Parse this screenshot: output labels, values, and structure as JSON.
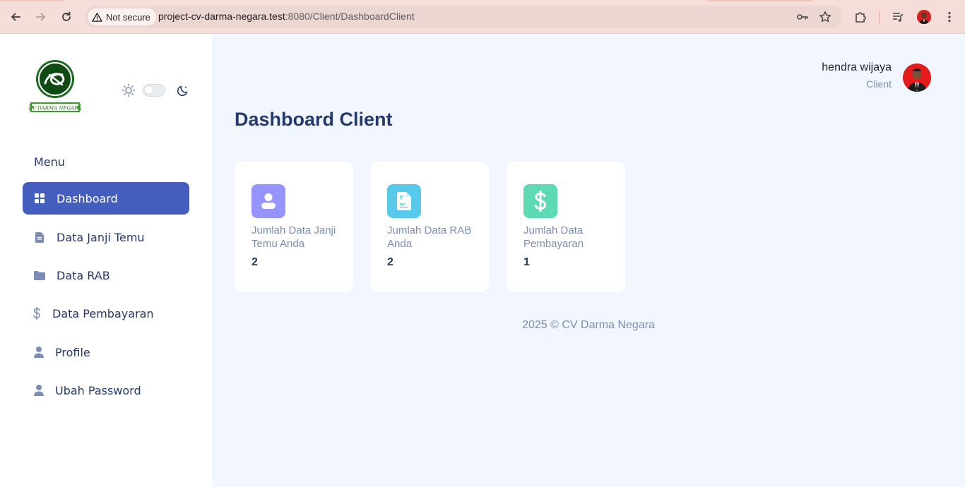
{
  "browser": {
    "security_label": "Not secure",
    "url_host": "project-cv-darma-negara.test",
    "url_path": ":8080/Client/DashboardClient"
  },
  "sidebar": {
    "logo_text": "CV DARMA NEGARA",
    "menu_title": "Menu",
    "items": [
      {
        "label": "Dashboard",
        "icon": "grid-icon",
        "active": true
      },
      {
        "label": "Data Janji Temu",
        "icon": "file-icon",
        "active": false
      },
      {
        "label": "Data RAB",
        "icon": "folder-icon",
        "active": false
      },
      {
        "label": "Data Pembayaran",
        "icon": "dollar-icon",
        "active": false
      },
      {
        "label": "Profile",
        "icon": "person-icon",
        "active": false
      },
      {
        "label": "Ubah Password",
        "icon": "person-icon",
        "active": false
      }
    ]
  },
  "header": {
    "user_name": "hendra wijaya",
    "user_role": "Client"
  },
  "main": {
    "title": "Dashboard Client",
    "cards": [
      {
        "label": "Jumlah Data Janji Temu Anda",
        "value": "2",
        "icon": "person-icon",
        "color": "#9694ff"
      },
      {
        "label": "Jumlah Data RAB Anda",
        "value": "2",
        "icon": "file-icon",
        "color": "#57caeb"
      },
      {
        "label": "Jumlah Data Pembayaran",
        "value": "1",
        "icon": "dollar-icon",
        "color": "#5ddab4"
      }
    ],
    "footer": "2025 © CV Darma Negara"
  },
  "colors": {
    "primary": "#435ebe",
    "text": "#25396f",
    "muted": "#7c8db5",
    "background": "#f2f7ff"
  }
}
